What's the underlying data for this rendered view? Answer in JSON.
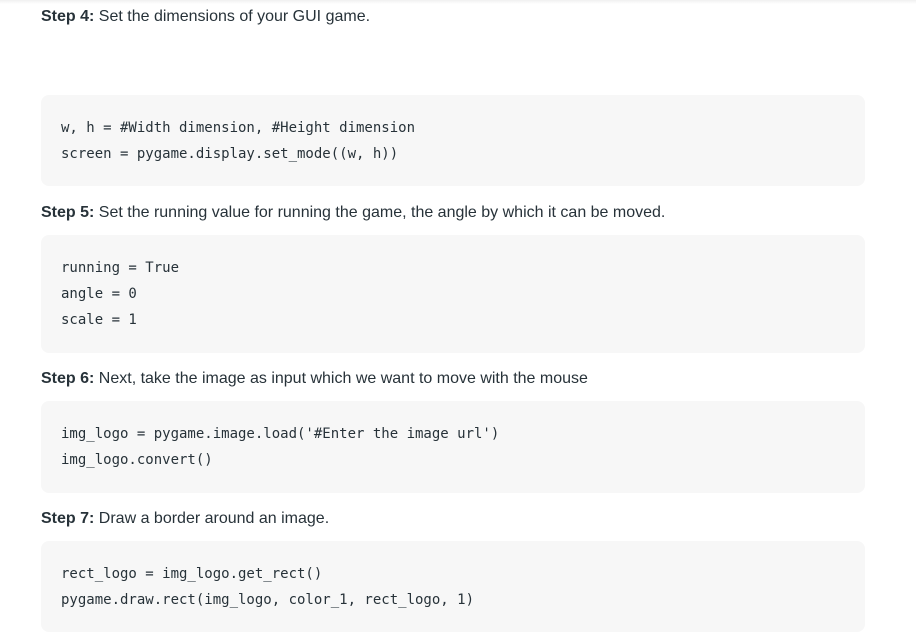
{
  "steps": [
    {
      "label": "Step 4:",
      "text": " Set the dimensions of your GUI game.",
      "code": [
        "w, h = #Width dimension, #Height dimension",
        "screen = pygame.display.set_mode((w, h))"
      ]
    },
    {
      "label": "Step 5:",
      "text": " Set the running value for running the game, the angle by which it can be moved.",
      "code": [
        "running = True",
        "angle = 0",
        "scale = 1"
      ]
    },
    {
      "label": "Step 6:",
      "text": " Next, take the image as input which we want to move with the mouse",
      "code": [
        "img_logo = pygame.image.load('#Enter the image url')",
        "img_logo.convert()"
      ]
    },
    {
      "label": "Step 7:",
      "text": " Draw a border around an image.",
      "code": [
        "rect_logo = img_logo.get_rect()",
        "pygame.draw.rect(img_logo, color_1, rect_logo, 1)"
      ]
    }
  ]
}
